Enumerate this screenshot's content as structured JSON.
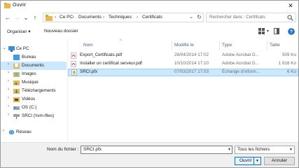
{
  "window": {
    "title": "Ouvrir",
    "close_symbol": "✕"
  },
  "nav": {
    "back": "←",
    "forward": "→",
    "dropdown": "⌄",
    "up": "↑"
  },
  "address": {
    "crumbs": [
      "Ce PC",
      "Documents",
      "Techniques",
      "Certificats"
    ],
    "separator": "›"
  },
  "search": {
    "placeholder": "Rechercher dans : Certificats"
  },
  "toolbar": {
    "organize": "Organiser ▾",
    "new_folder": "Nouveau dossier"
  },
  "sidebar": {
    "items": [
      {
        "label": "Ce PC",
        "icon": "computer-icon"
      },
      {
        "label": "Bureau",
        "icon": "desktop-folder-icon"
      },
      {
        "label": "Documents",
        "icon": "documents-folder-icon",
        "selected": true
      },
      {
        "label": "Images",
        "icon": "images-folder-icon"
      },
      {
        "label": "Musique",
        "icon": "music-folder-icon"
      },
      {
        "label": "Téléchargements",
        "icon": "downloads-folder-icon"
      },
      {
        "label": "Vidéos",
        "icon": "videos-folder-icon"
      },
      {
        "label": "OS (C:)",
        "icon": "drive-icon"
      },
      {
        "label": "SRCI (\\\\vm-files)",
        "icon": "network-drive-icon"
      },
      {
        "label": "Réseau",
        "icon": "network-icon"
      }
    ]
  },
  "columns": {
    "name": "Nom",
    "modified": "Modifié le",
    "type": "Type",
    "size": "Taille"
  },
  "files": [
    {
      "name": "Export_Certificats.pdf",
      "modified": "28/04/2014 17:02",
      "type": "Adobe Acrobat D...",
      "size": "509 Ko",
      "icon": "pdf-file-icon"
    },
    {
      "name": "Installer un certificat serveur.pdf",
      "modified": "10/10/2014 17:10",
      "type": "Adobe Acrobat D...",
      "size": "1 616 Ko",
      "icon": "pdf-file-icon"
    },
    {
      "name": "SRCI.pfx",
      "modified": "07/03/2017 17:03",
      "type": "Échange d'inform...",
      "size": "6 Ko",
      "icon": "certificate-file-icon",
      "selected": true
    }
  ],
  "bottom": {
    "filename_label": "Nom du fichier :",
    "filename_value": "SRCI.pfx",
    "filetype_value": "Tous les fichiers",
    "open_label": "Ouvrir",
    "cancel_label": "Annuler"
  },
  "colors": {
    "accent": "#0078d7",
    "selection": "#cce8ff",
    "folder": "#e8b84a"
  }
}
